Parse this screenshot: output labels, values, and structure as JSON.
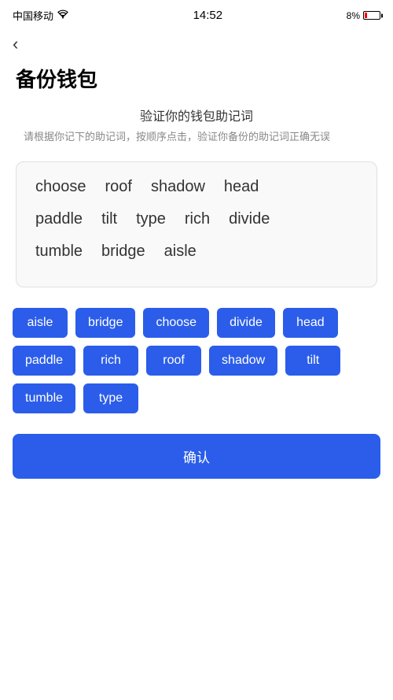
{
  "statusBar": {
    "carrier": "中国移动",
    "time": "14:52",
    "battery_percent": "8%"
  },
  "back": "‹",
  "pageTitle": "备份钱包",
  "sectionTitle": "验证你的钱包助记词",
  "sectionDesc": "请根据你记下的助记词，按顺序点击，验证你备份的助记词正确无误",
  "displayWords": {
    "row1": [
      "choose",
      "roof",
      "shadow",
      "head"
    ],
    "row2": [
      "paddle",
      "tilt",
      "type",
      "rich",
      "divide"
    ],
    "row3": [
      "tumble",
      "bridge",
      "aisle"
    ]
  },
  "chips": [
    "aisle",
    "bridge",
    "choose",
    "divide",
    "head",
    "paddle",
    "rich",
    "roof",
    "shadow",
    "tilt",
    "tumble",
    "type"
  ],
  "confirmLabel": "确认"
}
